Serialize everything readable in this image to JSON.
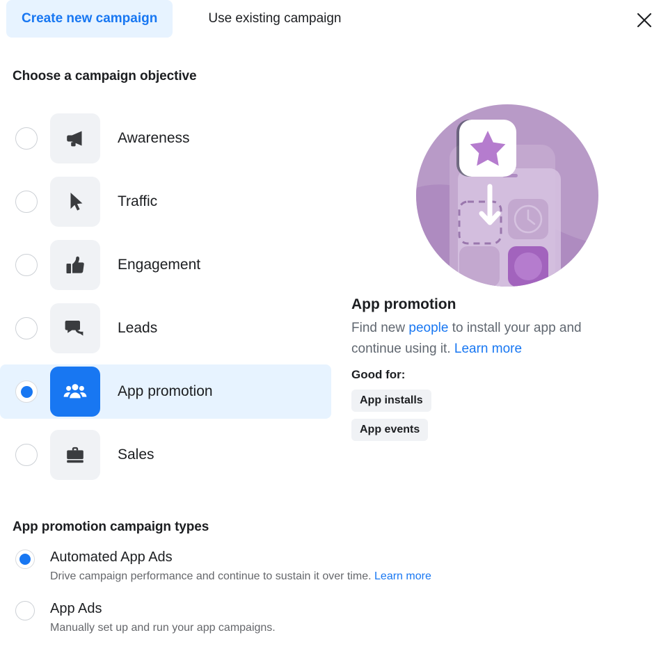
{
  "tabs": [
    {
      "label": "Create new campaign",
      "active": true
    },
    {
      "label": "Use existing campaign",
      "active": false
    }
  ],
  "close_icon": "close-icon",
  "objective_section": {
    "heading": "Choose a campaign objective",
    "options": [
      {
        "label": "Awareness",
        "icon": "megaphone-icon",
        "selected": false
      },
      {
        "label": "Traffic",
        "icon": "cursor-icon",
        "selected": false
      },
      {
        "label": "Engagement",
        "icon": "thumbs-up-icon",
        "selected": false
      },
      {
        "label": "Leads",
        "icon": "chat-bubbles-icon",
        "selected": false
      },
      {
        "label": "App promotion",
        "icon": "people-group-icon",
        "selected": true
      },
      {
        "label": "Sales",
        "icon": "briefcase-icon",
        "selected": false
      }
    ]
  },
  "detail": {
    "illustration": "app-promotion-illustration",
    "title": "App promotion",
    "description_part1": "Find new ",
    "description_link1": "people",
    "description_part2": " to install your app and continue using it. ",
    "description_link2": "Learn more",
    "good_for_label": "Good for:",
    "chips": [
      "App installs",
      "App events"
    ]
  },
  "campaign_types": {
    "heading": "App promotion campaign types",
    "options": [
      {
        "title": "Automated App Ads",
        "subtitle": "Drive campaign performance and continue to sustain it over time. ",
        "link": "Learn more",
        "selected": true
      },
      {
        "title": "App Ads",
        "subtitle": "Manually set up and run your app campaigns.",
        "link": "",
        "selected": false
      }
    ]
  },
  "colors": {
    "accent": "#1877f2",
    "highlight": "#e7f3ff",
    "tile": "#f0f2f5",
    "text": "#1c1e21",
    "muted": "#606770",
    "illustration_purple": "#b89ac7"
  }
}
